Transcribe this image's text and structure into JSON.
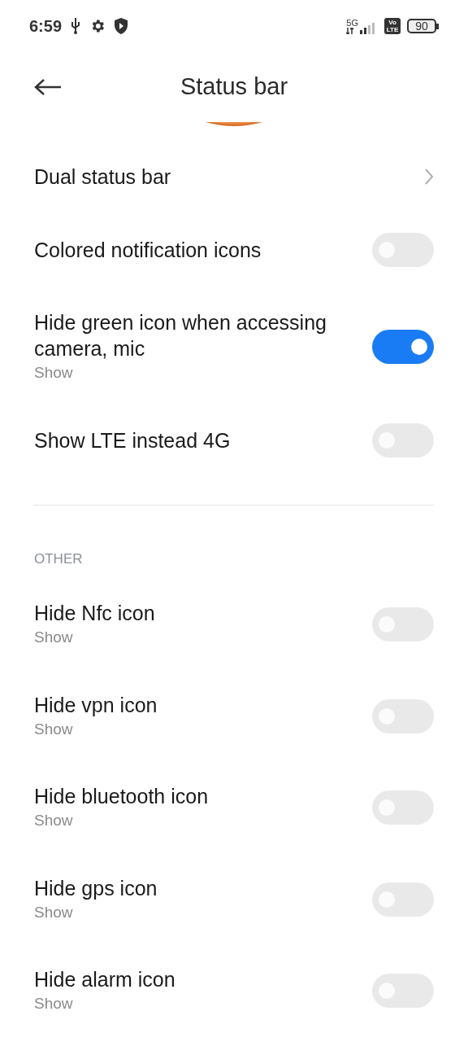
{
  "status_bar": {
    "time": "6:59",
    "network": "5G",
    "volte": "Vo LTE",
    "battery": "90"
  },
  "header": {
    "title": "Status bar"
  },
  "settings": [
    {
      "kind": "link",
      "label": "Dual status bar"
    },
    {
      "kind": "switch",
      "label": "Colored notification icons",
      "on": false
    },
    {
      "kind": "switch",
      "label": "Hide green icon when accessing camera, mic",
      "subtitle": "Show",
      "on": true
    },
    {
      "kind": "switch",
      "label": "Show LTE instead 4G",
      "on": false
    }
  ],
  "other": {
    "heading": "OTHER",
    "items": [
      {
        "kind": "switch",
        "label": "Hide Nfc icon",
        "subtitle": "Show",
        "on": false
      },
      {
        "kind": "switch",
        "label": "Hide vpn icon",
        "subtitle": "Show",
        "on": false
      },
      {
        "kind": "switch",
        "label": "Hide bluetooth icon",
        "subtitle": "Show",
        "on": false
      },
      {
        "kind": "switch",
        "label": "Hide gps icon",
        "subtitle": "Show",
        "on": false
      },
      {
        "kind": "switch",
        "label": "Hide alarm icon",
        "subtitle": "Show",
        "on": false
      }
    ]
  }
}
